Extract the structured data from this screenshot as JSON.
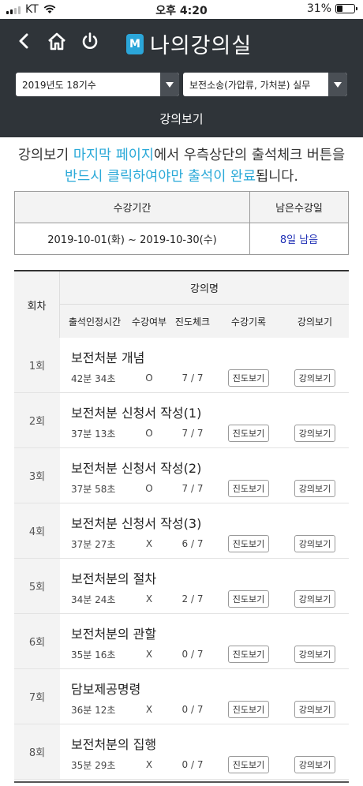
{
  "status_bar": {
    "carrier": "KT",
    "time": "오후 4:20",
    "battery": "31%",
    "battery_level": 0.31
  },
  "header": {
    "brand_logo": "M",
    "title": "나의강의실",
    "subtitle": "강의보기",
    "icons": [
      "back-icon",
      "home-icon",
      "power-icon"
    ],
    "select_year": "2019년도 18기수",
    "select_course": "보전소송(가압류, 가처분) 실무"
  },
  "notice": {
    "part1": "강의보기 ",
    "highlight1": "마지막 페이지",
    "part2": "에서 우측상단의 출석체크 버튼을",
    "highlight2": "반드시 클릭하여야만 출석이 완료",
    "part3": "됩니다."
  },
  "period": {
    "col_period": "수강기간",
    "col_remaining": "남은수강일",
    "period_value": "2019-10-01(화) ~ 2019-10-30(수)",
    "remaining_value": "8일 남음"
  },
  "lectures": {
    "headers": {
      "no": "회차",
      "name": "강의명",
      "time": "출석인정시간",
      "attended": "수강여부",
      "progress": "진도체크",
      "record": "수강기록",
      "view": "강의보기"
    },
    "progress_btn": "진도보기",
    "view_btn": "강의보기",
    "rows": [
      {
        "no": "1회",
        "title": "보전처분 개념",
        "time": "42분 34초",
        "attended": "O",
        "progress": "7 / 7"
      },
      {
        "no": "2회",
        "title": "보전처분 신청서 작성(1)",
        "time": "37분 13초",
        "attended": "O",
        "progress": "7 / 7"
      },
      {
        "no": "3회",
        "title": "보전처분 신청서 작성(2)",
        "time": "37분 58초",
        "attended": "O",
        "progress": "7 / 7"
      },
      {
        "no": "4회",
        "title": "보전처분 신청서 작성(3)",
        "time": "37분 27초",
        "attended": "X",
        "progress": "6 / 7"
      },
      {
        "no": "5회",
        "title": "보전처분의 절차",
        "time": "34분 24초",
        "attended": "X",
        "progress": "2 / 7"
      },
      {
        "no": "6회",
        "title": "보전처분의 관할",
        "time": "35분 16초",
        "attended": "X",
        "progress": "0 / 7"
      },
      {
        "no": "7회",
        "title": "담보제공명령",
        "time": "36분 12초",
        "attended": "X",
        "progress": "0 / 7"
      },
      {
        "no": "8회",
        "title": "보전처분의 집행",
        "time": "35분 29초",
        "attended": "X",
        "progress": "0 / 7"
      }
    ]
  },
  "colors": {
    "header_bg": "#2f3439",
    "accent": "#2aa9d8",
    "remaining": "#1e2fb5"
  }
}
